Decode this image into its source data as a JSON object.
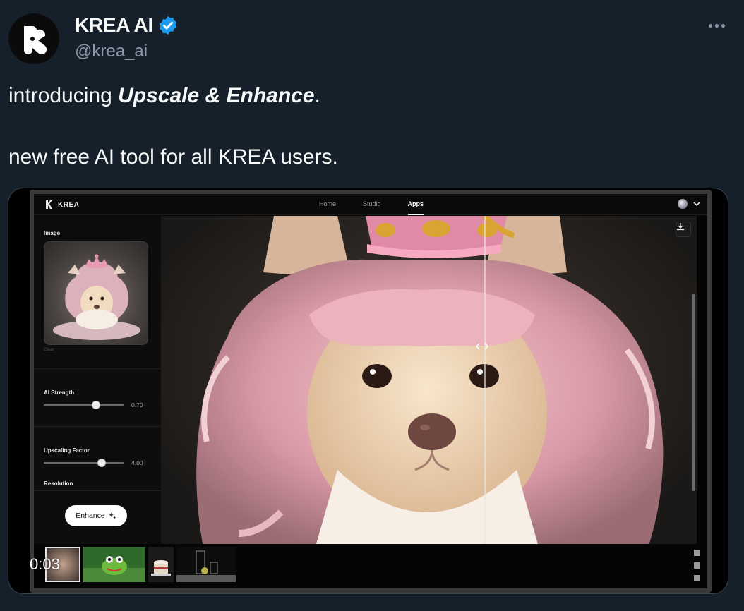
{
  "tweet": {
    "author_name": "KREA AI",
    "author_handle": "@krea_ai",
    "text_prefix": "introducing ",
    "text_emphasis": "Upscale & Enhance",
    "text_suffix": ".",
    "text_line2": "new free AI tool for all KREA users.",
    "verified_color": "#1d9bf0"
  },
  "media": {
    "timestamp": "0:03",
    "app": {
      "brand": "KREA",
      "nav": [
        {
          "label": "Home",
          "active": false
        },
        {
          "label": "Studio",
          "active": false
        },
        {
          "label": "Apps",
          "active": true
        }
      ],
      "left_panel": {
        "image_label": "Image",
        "image_caption": "Clear",
        "ai_strength": {
          "label": "AI Strength",
          "value": "0.70",
          "fraction": 0.65
        },
        "upscaling_factor": {
          "label": "Upscaling Factor",
          "value": "4.00",
          "fraction": 0.72
        },
        "resolution_label": "Resolution",
        "enhance_button": "Enhance"
      },
      "viewer": {
        "subject": "dog with pink wig and crown",
        "compare_split": 0.675
      }
    }
  },
  "icons": [
    "krea-logo-icon",
    "verified-badge-icon",
    "more-icon",
    "download-icon",
    "chevron-down-icon",
    "sparkle-icon",
    "compare-handle-icon"
  ]
}
